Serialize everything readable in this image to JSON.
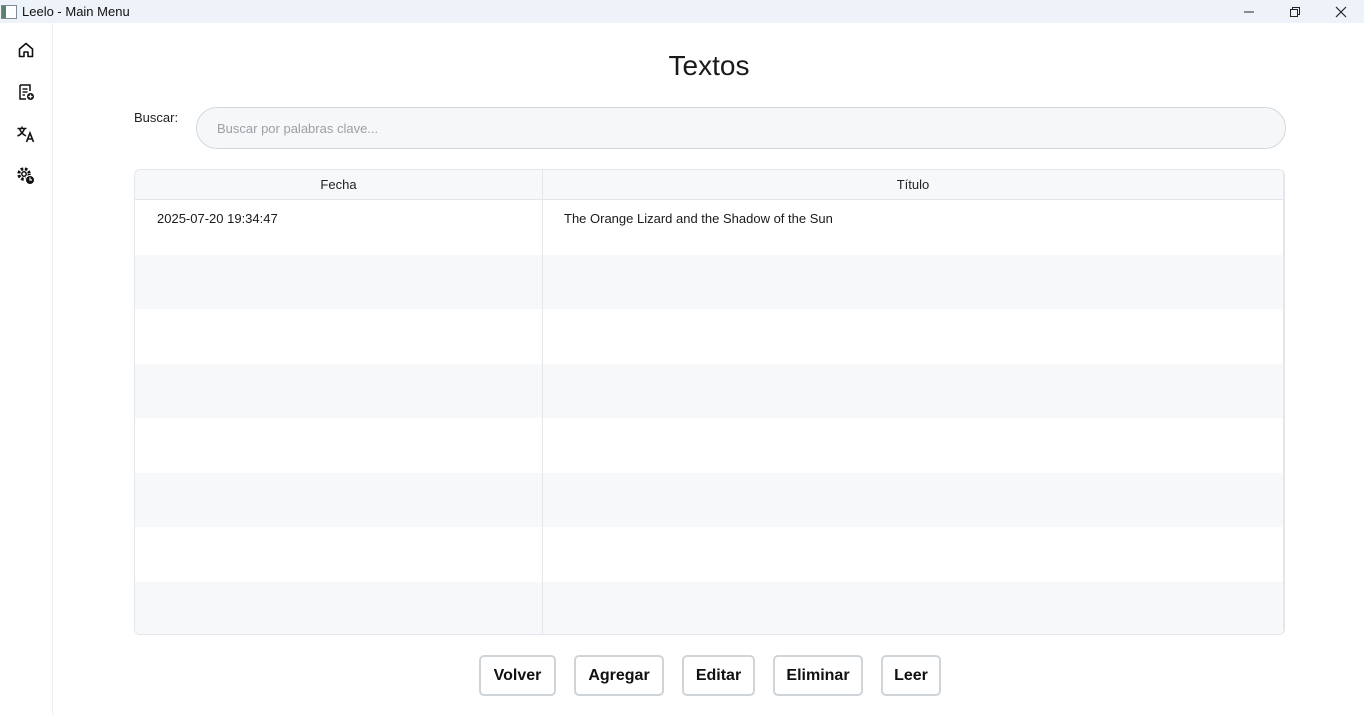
{
  "window": {
    "title": "Leelo - Main Menu"
  },
  "sidebar": {
    "items": [
      {
        "icon": "home-icon"
      },
      {
        "icon": "add-document-icon"
      },
      {
        "icon": "translate-icon"
      },
      {
        "icon": "settings-icon"
      }
    ]
  },
  "page": {
    "title": "Textos"
  },
  "search": {
    "label": "Buscar:",
    "placeholder": "Buscar por palabras clave...",
    "value": ""
  },
  "table": {
    "columns": [
      "Fecha",
      "Título"
    ],
    "rows": [
      {
        "fecha": "2025-07-20 19:34:47",
        "titulo": "The Orange Lizard and the Shadow of the Sun"
      }
    ]
  },
  "actions": {
    "volver": "Volver",
    "agregar": "Agregar",
    "editar": "Editar",
    "eliminar": "Eliminar",
    "leer": "Leer"
  },
  "colors": {
    "background": "#ffffff",
    "titlebar": "#eef3f9",
    "stripe": "#f6f8fa",
    "border": "#e3e6ea"
  }
}
